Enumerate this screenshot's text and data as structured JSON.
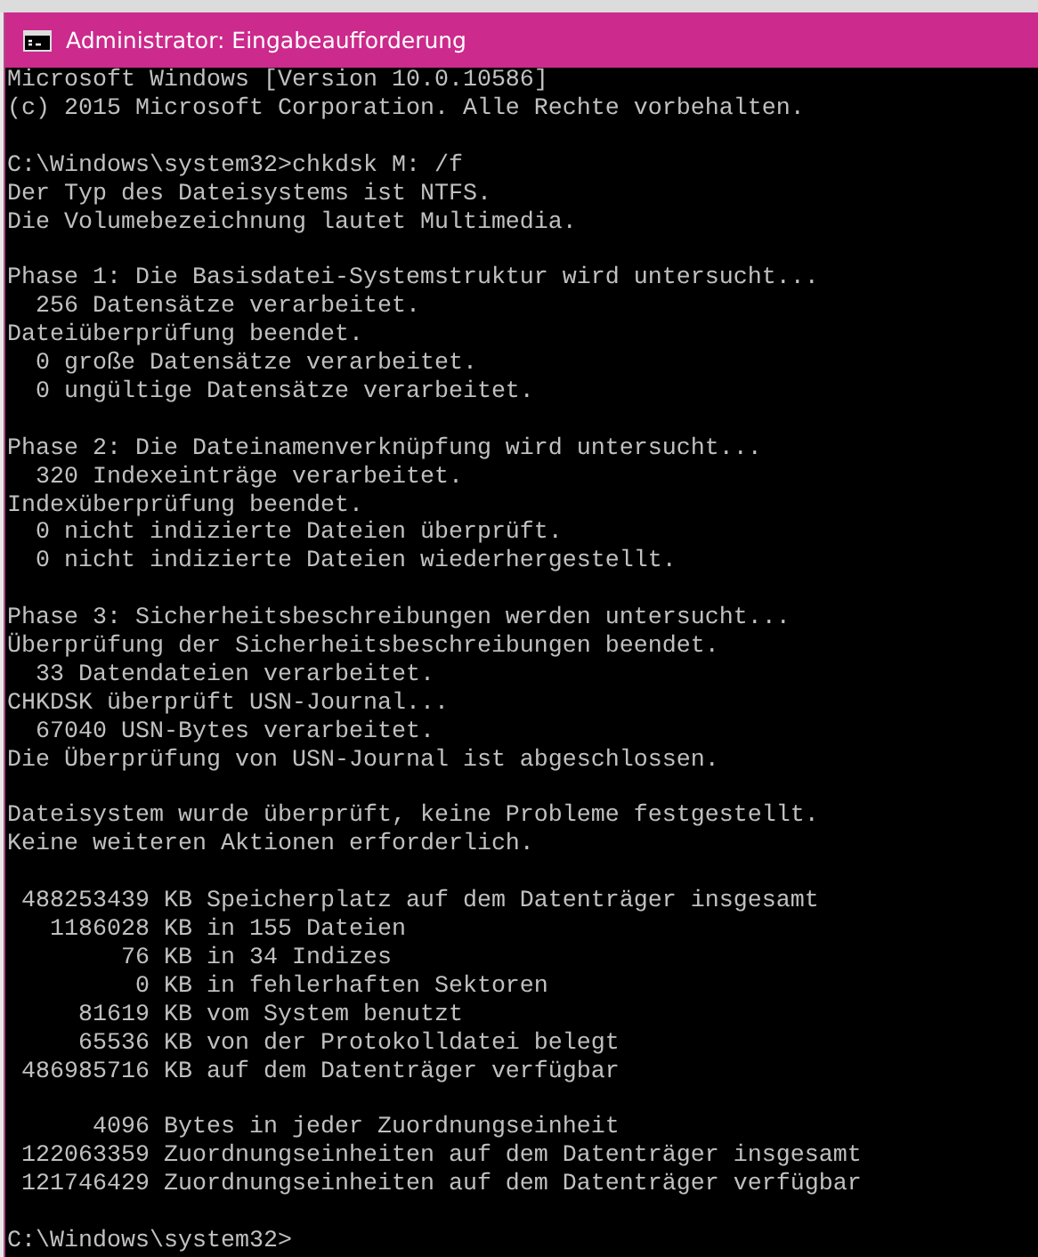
{
  "window": {
    "title": "Administrator: Eingabeaufforderung"
  },
  "console": {
    "blocks": [
      [
        "Microsoft Windows [Version 10.0.10586]",
        "(c) 2015 Microsoft Corporation. Alle Rechte vorbehalten."
      ],
      [
        "C:\\Windows\\system32>chkdsk M: /f",
        "Der Typ des Dateisystems ist NTFS.",
        "Die Volumebezeichnung lautet Multimedia."
      ],
      [
        "Phase 1: Die Basisdatei-Systemstruktur wird untersucht...",
        "  256 Datensätze verarbeitet.",
        "Dateiüberprüfung beendet.",
        "  0 große Datensätze verarbeitet.",
        "  0 ungültige Datensätze verarbeitet."
      ],
      [
        "Phase 2: Die Dateinamenverknüpfung wird untersucht...",
        "  320 Indexeinträge verarbeitet.",
        "Indexüberprüfung beendet.",
        "  0 nicht indizierte Dateien überprüft.",
        "  0 nicht indizierte Dateien wiederhergestellt."
      ],
      [
        "Phase 3: Sicherheitsbeschreibungen werden untersucht...",
        "Überprüfung der Sicherheitsbeschreibungen beendet.",
        "  33 Datendateien verarbeitet.",
        "CHKDSK überprüft USN-Journal...",
        "  67040 USN-Bytes verarbeitet.",
        "Die Überprüfung von USN-Journal ist abgeschlossen."
      ],
      [
        "Dateisystem wurde überprüft, keine Probleme festgestellt.",
        "Keine weiteren Aktionen erforderlich."
      ],
      [
        " 488253439 KB Speicherplatz auf dem Datenträger insgesamt",
        "   1186028 KB in 155 Dateien",
        "        76 KB in 34 Indizes",
        "         0 KB in fehlerhaften Sektoren",
        "     81619 KB vom System benutzt",
        "     65536 KB von der Protokolldatei belegt",
        " 486985716 KB auf dem Datenträger verfügbar"
      ],
      [
        "      4096 Bytes in jeder Zuordnungseinheit",
        " 122063359 Zuordnungseinheiten auf dem Datenträger insgesamt",
        " 121746429 Zuordnungseinheiten auf dem Datenträger verfügbar"
      ],
      [
        "C:\\Windows\\system32>"
      ]
    ]
  }
}
